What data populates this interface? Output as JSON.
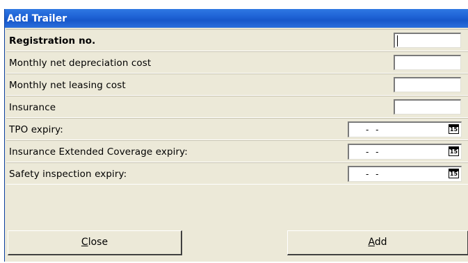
{
  "window": {
    "title": "Add Trailer"
  },
  "fields": [
    {
      "label": "Registration no.",
      "type": "text",
      "value": ""
    },
    {
      "label": "Monthly net depreciation cost",
      "type": "text",
      "value": ""
    },
    {
      "label": "Monthly net leasing cost",
      "type": "text",
      "value": ""
    },
    {
      "label": "Insurance",
      "type": "text",
      "value": ""
    },
    {
      "label": "TPO expiry:",
      "type": "date",
      "value": "- -"
    },
    {
      "label": "Insurance Extended Coverage expiry:",
      "type": "date",
      "value": "- -"
    },
    {
      "label": "Safety inspection expiry:",
      "type": "date",
      "value": "- -"
    }
  ],
  "calendar_icon_text": "15",
  "buttons": {
    "close": {
      "mnemonic": "C",
      "rest": "lose"
    },
    "add": {
      "mnemonic": "A",
      "rest": "dd"
    }
  }
}
